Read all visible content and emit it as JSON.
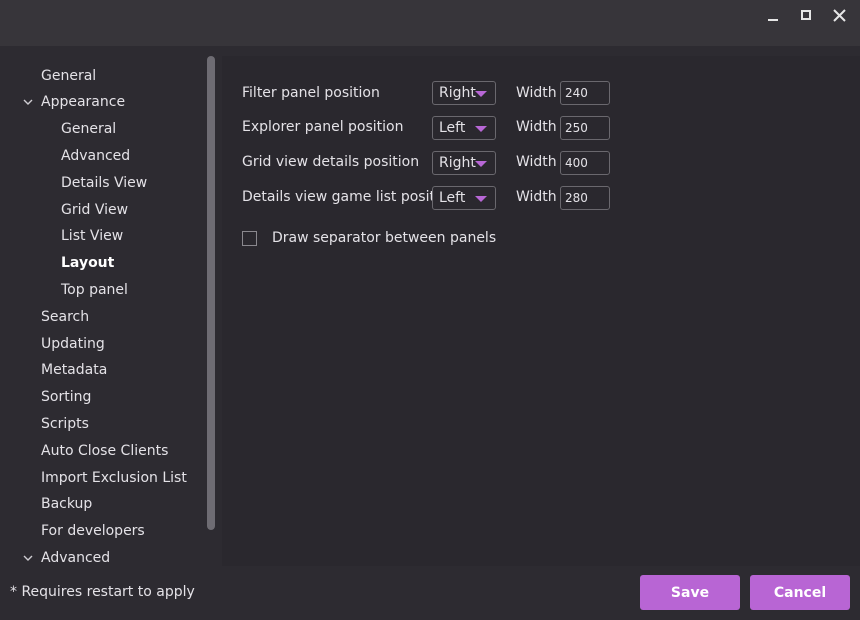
{
  "window": {
    "minimize_icon": "minimize-icon",
    "maximize_icon": "maximize-icon",
    "close_icon": "close-icon"
  },
  "sidebar": {
    "items": [
      {
        "label": "General",
        "level": 0
      },
      {
        "label": "Appearance",
        "level": 0,
        "expanded": true
      },
      {
        "label": "General",
        "level": 1
      },
      {
        "label": "Advanced",
        "level": 1
      },
      {
        "label": "Details View",
        "level": 1
      },
      {
        "label": "Grid View",
        "level": 1
      },
      {
        "label": "List View",
        "level": 1
      },
      {
        "label": "Layout",
        "level": 1,
        "selected": true
      },
      {
        "label": "Top panel",
        "level": 1
      },
      {
        "label": "Search",
        "level": 0
      },
      {
        "label": "Updating",
        "level": 0
      },
      {
        "label": "Metadata",
        "level": 0
      },
      {
        "label": "Sorting",
        "level": 0
      },
      {
        "label": "Scripts",
        "level": 0
      },
      {
        "label": "Auto Close Clients",
        "level": 0
      },
      {
        "label": "Import Exclusion List",
        "level": 0
      },
      {
        "label": "Backup",
        "level": 0
      },
      {
        "label": "For developers",
        "level": 0
      },
      {
        "label": "Advanced",
        "level": 0,
        "expanded": true
      }
    ]
  },
  "layout": {
    "rows": [
      {
        "label": "Filter panel position",
        "position": "Right",
        "width_label": "Width",
        "width": "240"
      },
      {
        "label": "Explorer panel position",
        "position": "Left",
        "width_label": "Width",
        "width": "250"
      },
      {
        "label": "Grid view details position",
        "position": "Right",
        "width_label": "Width",
        "width": "400"
      },
      {
        "label": "Details view game list position",
        "position": "Left",
        "width_label": "Width",
        "width": "280"
      }
    ],
    "separator_label": "Draw separator between panels",
    "separator_checked": false
  },
  "footer": {
    "note": "* Requires restart to apply",
    "save_label": "Save",
    "cancel_label": "Cancel"
  },
  "colors": {
    "accent": "#b865d4",
    "background": "#2d2b31",
    "titlebar": "#37353a"
  }
}
